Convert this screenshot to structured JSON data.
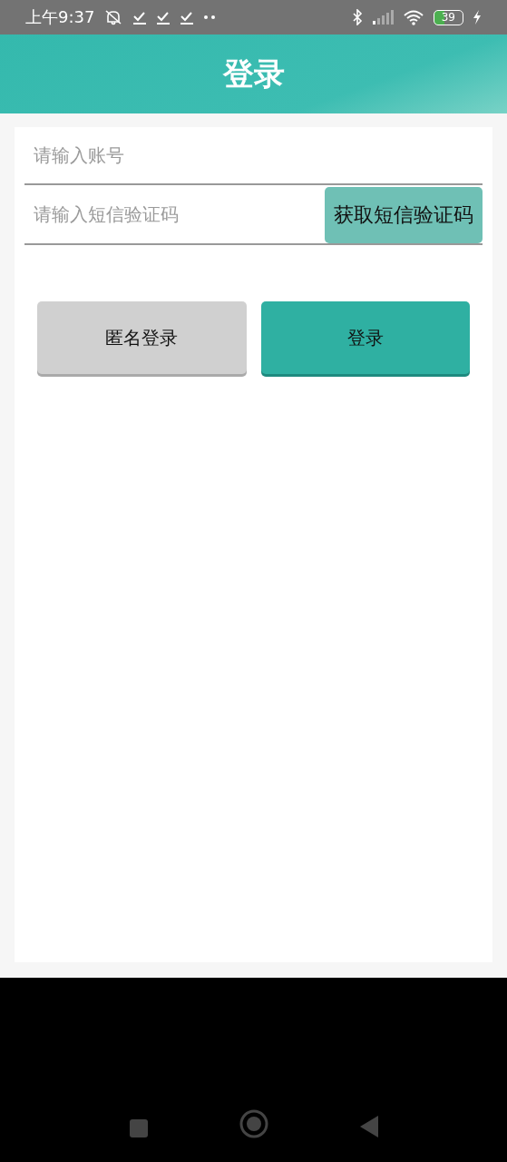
{
  "status_bar": {
    "time": "上午9:37",
    "battery": "39"
  },
  "header": {
    "title": "登录"
  },
  "form": {
    "account": {
      "placeholder": "请输入账号"
    },
    "code": {
      "placeholder": "请输入短信验证码"
    },
    "code_button": "获取短信验证码"
  },
  "buttons": [
    {
      "label": "匿名登录",
      "kind": "secondary"
    },
    {
      "label": "登录",
      "kind": "primary"
    }
  ]
}
